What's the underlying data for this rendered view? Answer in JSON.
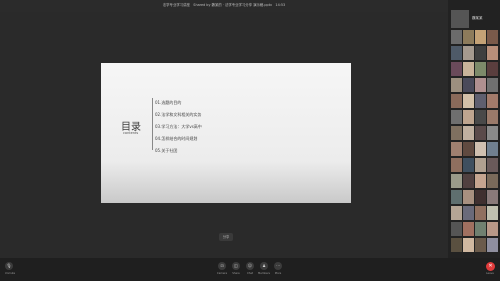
{
  "window": {
    "title": "法学专业学习讲座　Shared by 魏某的 · 法学专业学习分享 演示稿.pptx　14:53"
  },
  "slide": {
    "heading": "目录",
    "subheading": "contents",
    "items": [
      "01.选题的目的",
      "02.法学和文科相关的实务",
      "03.学习方法：大学vs高中",
      "04.怎样结合的时间规划",
      "05.关于社团"
    ]
  },
  "share_button": {
    "label": "分享"
  },
  "participants": {
    "host_name": "魏某某",
    "thumbs": [
      "#6b6b6b",
      "#8d7b5b",
      "#c4a276",
      "#7a5a4a",
      "#4e5a68",
      "#a59a8f",
      "#3f3f3f",
      "#b88f7a",
      "#6a4a5a",
      "#c9b39a",
      "#7d8a6a",
      "#5a3e3e",
      "#9c8f7f",
      "#4a4a5a",
      "#b09090",
      "#707070",
      "#8a6a5a",
      "#d3c0a8",
      "#5f5f6f",
      "#a37b6b",
      "#6f6f6f",
      "#bfa58f",
      "#494949",
      "#9a7a6a",
      "#7f7060",
      "#c0b0a0",
      "#5a4a4a",
      "#8a8a8a",
      "#a08070",
      "#604a40",
      "#d0c0b0",
      "#707f8f",
      "#8f6f5f",
      "#3f4f5f",
      "#b0a090",
      "#6a5a5a",
      "#9a9a8a",
      "#504040",
      "#c5a590",
      "#7a6a5a",
      "#5f6f6f",
      "#a89080",
      "#403030",
      "#8a7a7a",
      "#b5a595",
      "#6a6a7a",
      "#907060",
      "#c0c0b0",
      "#555555",
      "#a07060",
      "#708070",
      "#b89888",
      "#5a5040",
      "#d0b8a0",
      "#6b5b4b",
      "#8f8f9f",
      "#7a6050",
      "#a0a0a0",
      "#4f3f3f",
      "#c8b098",
      "#6e6e5e",
      "#9e7e6e",
      "#5e5e6e",
      "#b8a888",
      "#707050",
      "#8a5a4a",
      "#c0a8a0",
      "#4a5a5a"
    ]
  },
  "toolbar": {
    "mic_label": "Unmute",
    "buttons": [
      {
        "icon": "⊡",
        "label": "Camera"
      },
      {
        "icon": "◫",
        "label": "Share"
      },
      {
        "icon": "☺",
        "label": "Chat"
      },
      {
        "icon": "♟",
        "label": "Members"
      },
      {
        "icon": "⋯",
        "label": "More"
      }
    ],
    "leave_label": "Leave"
  }
}
